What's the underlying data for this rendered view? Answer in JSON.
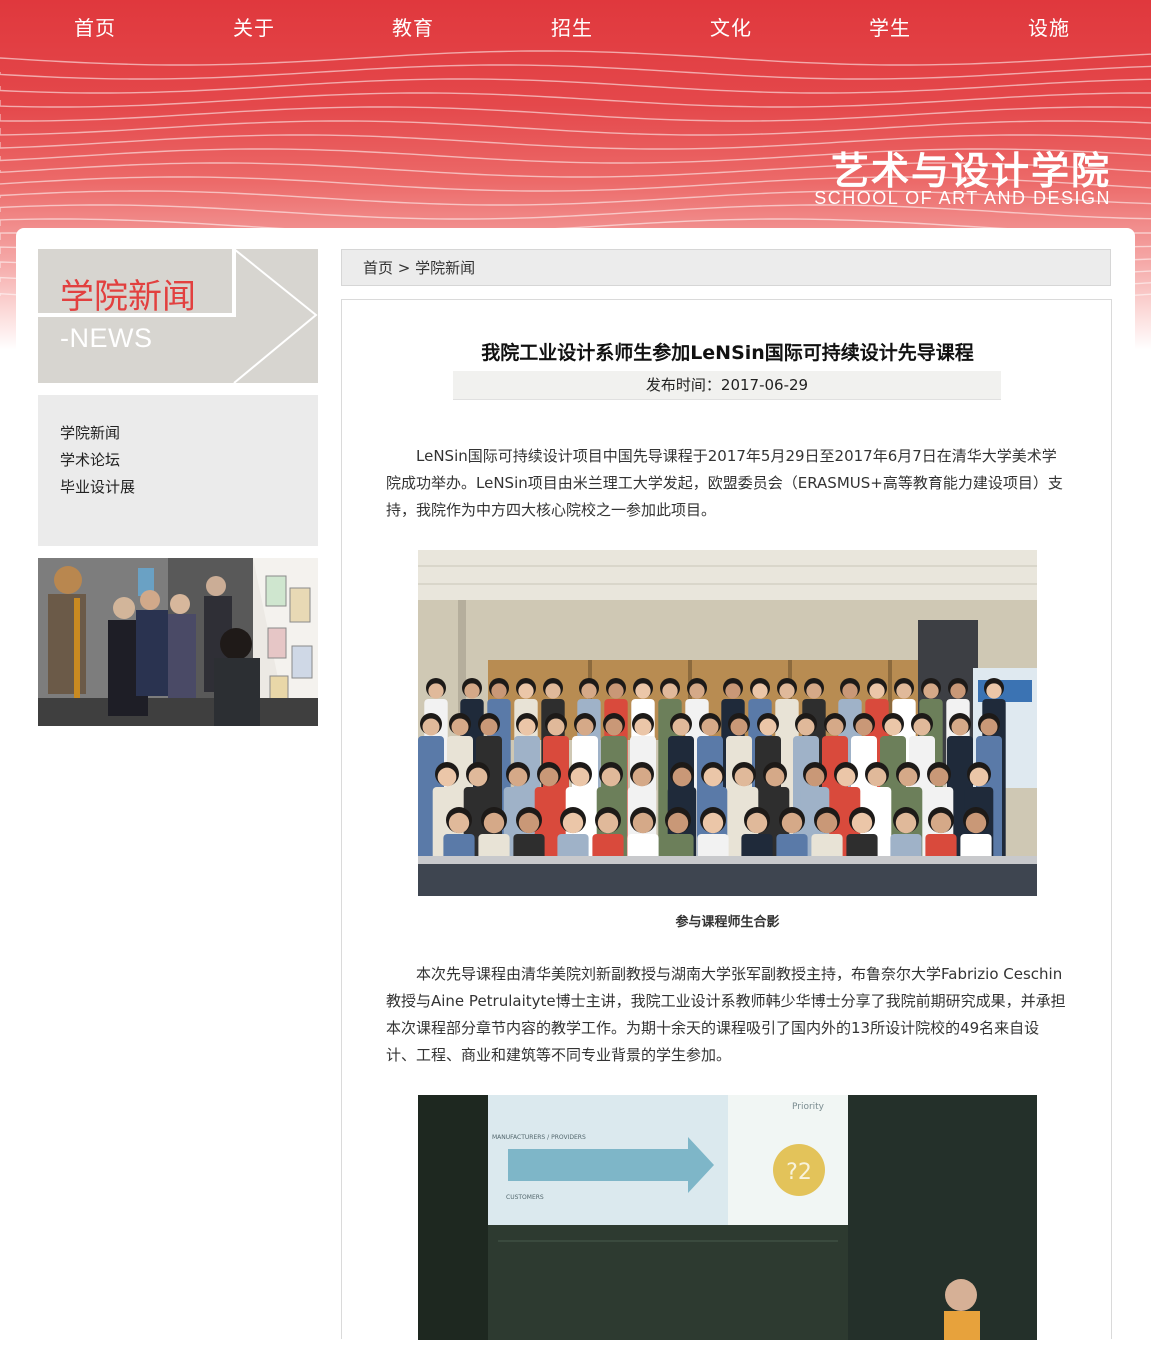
{
  "nav": {
    "items": [
      {
        "label": "首页"
      },
      {
        "label": "关于"
      },
      {
        "label": "教育"
      },
      {
        "label": "招生"
      },
      {
        "label": "文化"
      },
      {
        "label": "学生"
      },
      {
        "label": "设施"
      }
    ]
  },
  "brand": {
    "name_cn": "艺术与设计学院",
    "name_en": "SCHOOL OF ART AND DESIGN"
  },
  "sidebar": {
    "title_cn": "学院新闻",
    "title_en": "-NEWS",
    "menu": [
      {
        "label": "学院新闻"
      },
      {
        "label": "学术论坛"
      },
      {
        "label": "毕业设计展"
      }
    ]
  },
  "breadcrumb": {
    "home": "首页",
    "separator": ">",
    "current": "学院新闻"
  },
  "article": {
    "title": "我院工业设计系师生参加LeNSin国际可持续设计先导课程",
    "date_label": "发布时间：",
    "date": "2017-06-29",
    "paragraph1": "LeNSin国际可持续设计项目中国先导课程于2017年5月29日至2017年6月7日在清华大学美术学院成功举办。LeNSin项目由米兰理工大学发起，欧盟委员会（ERASMUS+高等教育能力建设项目）支持，我院作为中方四大核心院校之一参加此项目。",
    "photo1_caption": "参与课程师生合影",
    "paragraph2": "本次先导课程由清华美院刘新副教授与湖南大学张军副教授主持，布鲁奈尔大学Fabrizio Ceschin教授与Aine Petrulaityte博士主讲，我院工业设计系教师韩少华博士分享了我院前期研究成果，并承担本次课程部分章节内容的教学工作。为期十余天的课程吸引了国内外的13所设计院校的49名来自设计、工程、商业和建筑等不同专业背景的学生参加。",
    "slide": {
      "heading": "Priority",
      "row1_label": "MANUFACTURERS / PROVIDERS",
      "row2_label": "CUSTOMERS",
      "badge": "?2"
    }
  },
  "colors": {
    "brand_red": "#e2403f",
    "banner_red": "#e0383d",
    "sidebar_grey": "#d7d5d0"
  }
}
